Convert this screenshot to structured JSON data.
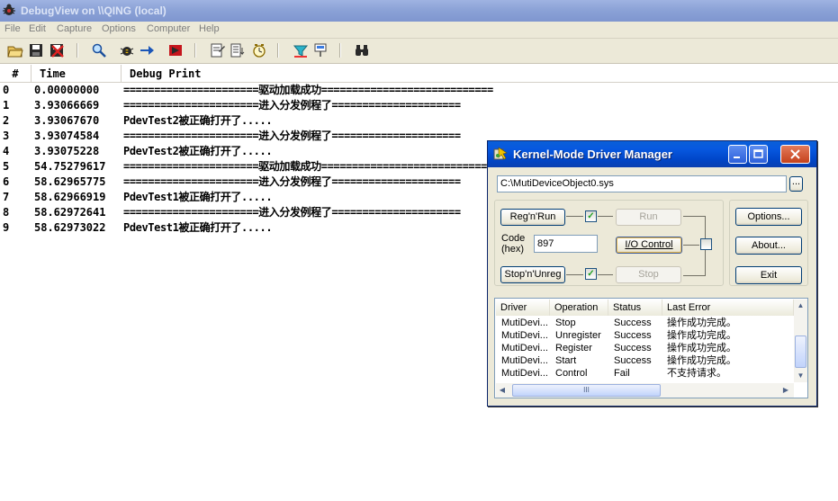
{
  "window": {
    "title": "DebugView on \\\\QING (local)"
  },
  "menu": [
    "File",
    "Edit",
    "Capture",
    "Options",
    "Computer",
    "Help"
  ],
  "toolbar": {
    "icons": [
      "open-icon",
      "save-icon",
      "clear-display-icon",
      "find-icon",
      "capture-icon",
      "autoscroll-icon",
      "capture-kernel-icon",
      "filter-icon",
      "history-icon",
      "clock-icon",
      "highlight-icon",
      "pin-icon",
      "binoculars-icon"
    ]
  },
  "log": {
    "columns": [
      "#",
      "Time",
      "Debug Print"
    ],
    "rows": [
      {
        "num": "0",
        "time": "0.00000000",
        "msg": "======================驱动加载成功============================"
      },
      {
        "num": "1",
        "time": "3.93066669",
        "msg": "======================进入分发例程了====================="
      },
      {
        "num": "2",
        "time": "3.93067670",
        "msg": "PdevTest2被正确打开了....."
      },
      {
        "num": "3",
        "time": "3.93074584",
        "msg": "======================进入分发例程了====================="
      },
      {
        "num": "4",
        "time": "3.93075228",
        "msg": "PdevTest2被正确打开了....."
      },
      {
        "num": "5",
        "time": "54.75279617",
        "msg": "======================驱动加载成功============================"
      },
      {
        "num": "6",
        "time": "58.62965775",
        "msg": "======================进入分发例程了====================="
      },
      {
        "num": "7",
        "time": "58.62966919",
        "msg": "PdevTest1被正确打开了....."
      },
      {
        "num": "8",
        "time": "58.62972641",
        "msg": "======================进入分发例程了====================="
      },
      {
        "num": "9",
        "time": "58.62973022",
        "msg": "PdevTest1被正确打开了....."
      }
    ]
  },
  "dialog": {
    "title": "Kernel-Mode Driver Manager",
    "driver_path": "C:\\MutiDeviceObject0.sys",
    "browse_label": "...",
    "buttons": {
      "reg_run": "Reg'n'Run",
      "run": "Run",
      "io_control": "I/O Control",
      "stop_unreg": "Stop'n'Unreg",
      "stop": "Stop",
      "options": "Options...",
      "about": "About...",
      "exit": "Exit"
    },
    "code_label_1": "Code",
    "code_label_2": "(hex)",
    "code_value": "897",
    "list": {
      "columns": [
        "Driver",
        "Operation",
        "Status",
        "Last Error"
      ],
      "rows": [
        {
          "driver": "MutiDevi...",
          "operation": "Stop",
          "status": "Success",
          "error": "操作成功完成。"
        },
        {
          "driver": "MutiDevi...",
          "operation": "Unregister",
          "status": "Success",
          "error": "操作成功完成。"
        },
        {
          "driver": "MutiDevi...",
          "operation": "Register",
          "status": "Success",
          "error": "操作成功完成。"
        },
        {
          "driver": "MutiDevi...",
          "operation": "Start",
          "status": "Success",
          "error": "操作成功完成。"
        },
        {
          "driver": "MutiDevi...",
          "operation": "Control",
          "status": "Fail",
          "error": "不支持请求。"
        }
      ]
    },
    "hscroll_grip": "III"
  }
}
